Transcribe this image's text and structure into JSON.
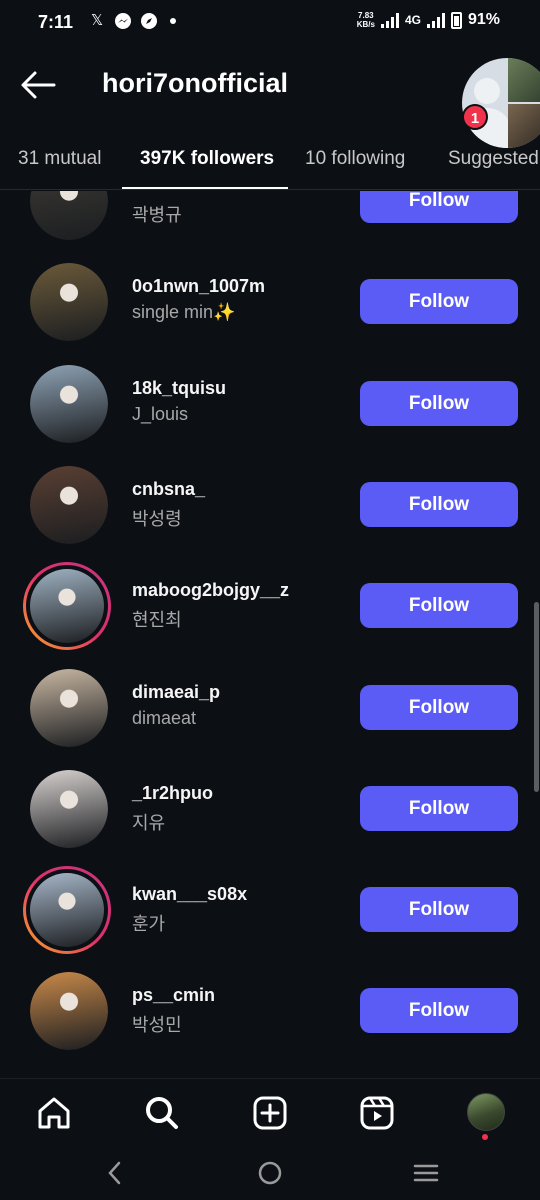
{
  "status_bar": {
    "time": "7:11",
    "net_speed_value": "7.83",
    "net_speed_unit": "KB/s",
    "network": "4G",
    "battery": "91%"
  },
  "header": {
    "username": "hori7onofficial",
    "notification_count": "1"
  },
  "tabs": [
    {
      "label": "31 mutual"
    },
    {
      "label": "397K followers"
    },
    {
      "label": "10 following"
    },
    {
      "label": "Suggested"
    }
  ],
  "follow_label": "Follow",
  "followers": [
    {
      "username": "",
      "name": "곽병규",
      "avatar_color": "#3e3b36"
    },
    {
      "username": "0o1nwn_1007m",
      "name": "single min✨",
      "avatar_color": "#6b5a3a"
    },
    {
      "username": "18k_tquisu",
      "name": "J_louis",
      "avatar_color": "#8fa3b5"
    },
    {
      "username": "cnbsna_",
      "name": "박성령",
      "avatar_color": "#5a4033"
    },
    {
      "username": "maboog2bojgy__z",
      "name": "현진최",
      "avatar_color": "#9fb2c2"
    },
    {
      "username": "dimaeai_p",
      "name": "dimaeat",
      "avatar_color": "#c9b8a3"
    },
    {
      "username": "_1r2hpuo",
      "name": "지유",
      "avatar_color": "#d8d2d0"
    },
    {
      "username": "kwan___s08x",
      "name": "훈가",
      "avatar_color": "#a7b7c9"
    },
    {
      "username": "ps__cmin",
      "name": "박성민",
      "avatar_color": "#c98a4a"
    }
  ]
}
